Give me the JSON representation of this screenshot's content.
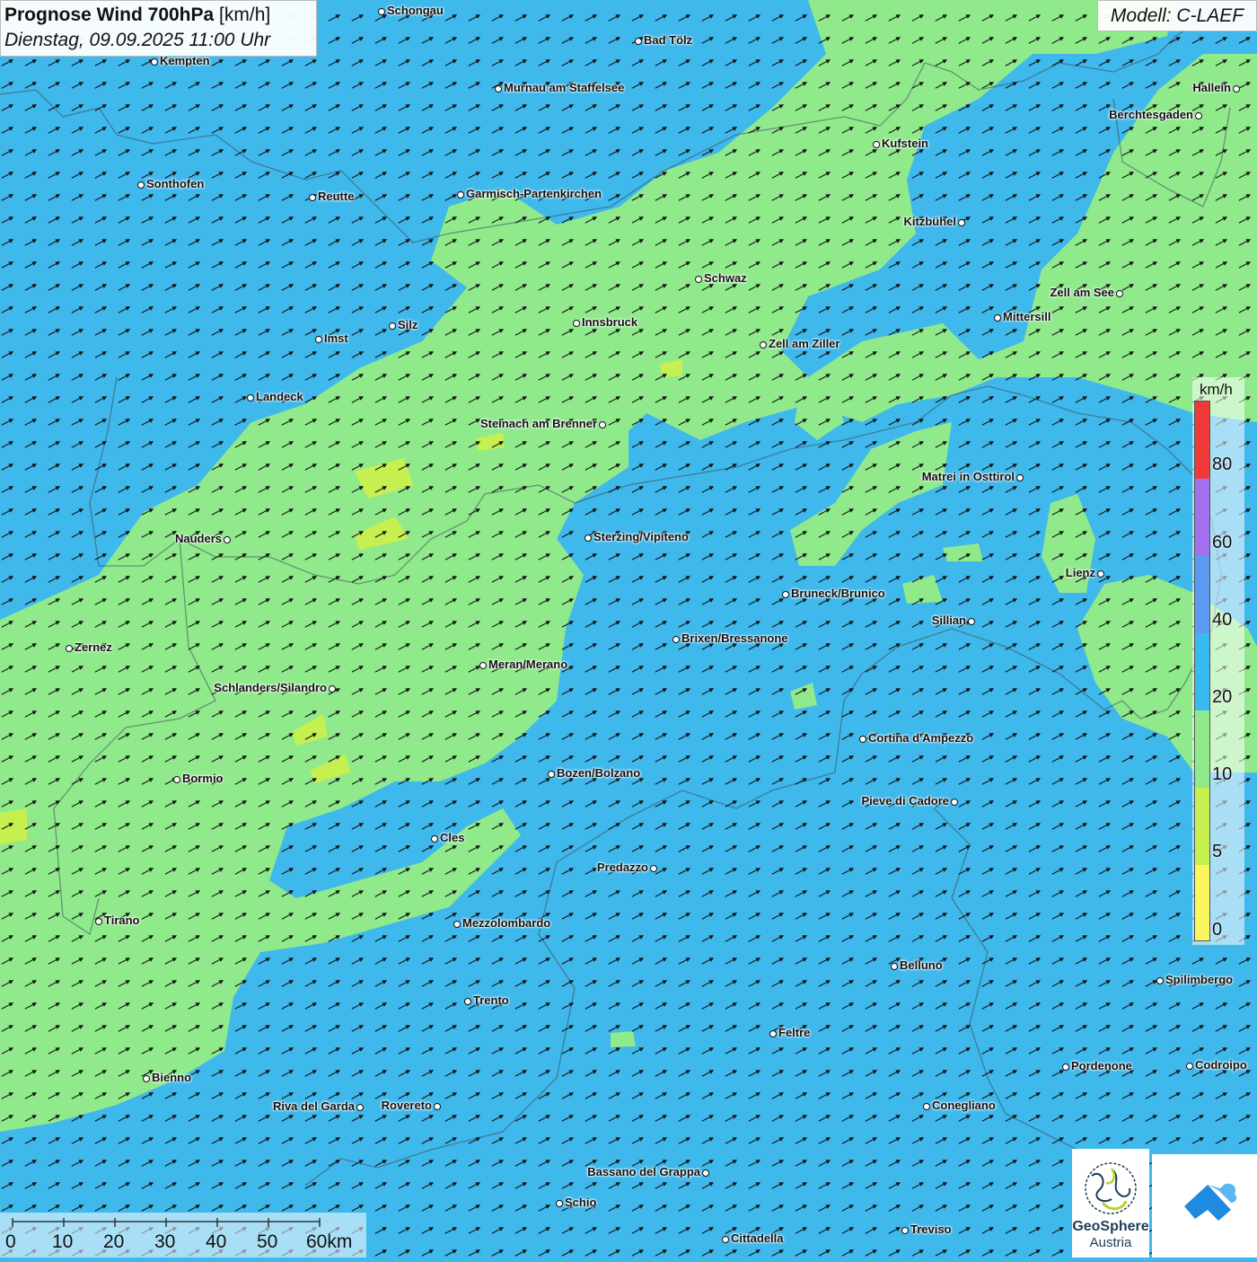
{
  "header": {
    "title_bold": "Prognose Wind 700hPa",
    "title_unit": "[km/h]",
    "datetime": "Dienstag, 09.09.2025 11:00 Uhr"
  },
  "model": "Modell: C-LAEF",
  "legend": {
    "unit": "km/h",
    "ticks": [
      "80",
      "60",
      "40",
      "20",
      "10",
      "5",
      "0"
    ],
    "colors": [
      "#f03a3a",
      "#a070ee",
      "#5a9af0",
      "#38b9ef",
      "#90ea8c",
      "#c5f050",
      "#fbf560"
    ]
  },
  "scalebar": {
    "labels": [
      "0",
      "10",
      "20",
      "30",
      "40",
      "50",
      "60km"
    ]
  },
  "logos": {
    "geosphere_line1": "GeoSphere",
    "geosphere_line2": "Austria"
  },
  "cities": [
    {
      "name": "Schongau"
    },
    {
      "name": "Bad Tölz"
    },
    {
      "name": "Kempten"
    },
    {
      "name": "Murnau am Staffelsee"
    },
    {
      "name": "Hallein"
    },
    {
      "name": "Berchtesgaden"
    },
    {
      "name": "Kufstein"
    },
    {
      "name": "Sonthofen"
    },
    {
      "name": "Reutte"
    },
    {
      "name": "Garmisch-Partenkirchen"
    },
    {
      "name": "Kitzbühel"
    },
    {
      "name": "Schwaz"
    },
    {
      "name": "Zell am See"
    },
    {
      "name": "Innsbruck"
    },
    {
      "name": "Mittersill"
    },
    {
      "name": "Silz"
    },
    {
      "name": "Imst"
    },
    {
      "name": "Zell am Ziller"
    },
    {
      "name": "Landeck"
    },
    {
      "name": "Steinach am Brenner"
    },
    {
      "name": "Matrei in Osttirol"
    },
    {
      "name": "Nauders"
    },
    {
      "name": "Sterzing/Vipiteno"
    },
    {
      "name": "Lienz"
    },
    {
      "name": "Bruneck/Brunico"
    },
    {
      "name": "Sillian"
    },
    {
      "name": "Brixen/Bressanone"
    },
    {
      "name": "Zernez"
    },
    {
      "name": "Meran/Merano"
    },
    {
      "name": "Schlanders/Silandro"
    },
    {
      "name": "Cortina d'Ampezzo"
    },
    {
      "name": "Bozen/Bolzano"
    },
    {
      "name": "Bormio"
    },
    {
      "name": "Pieve di Cadore"
    },
    {
      "name": "Cles"
    },
    {
      "name": "Predazzo"
    },
    {
      "name": "Tirano"
    },
    {
      "name": "Mezzolombardo"
    },
    {
      "name": "Belluno"
    },
    {
      "name": "Spilimbergo"
    },
    {
      "name": "Trento"
    },
    {
      "name": "Feltre"
    },
    {
      "name": "Pordenone"
    },
    {
      "name": "Codroipo"
    },
    {
      "name": "Bienno"
    },
    {
      "name": "Riva del Garda"
    },
    {
      "name": "Rovereto"
    },
    {
      "name": "Conegliano"
    },
    {
      "name": "Bassano del Grappa"
    },
    {
      "name": "Schio"
    },
    {
      "name": "Treviso"
    },
    {
      "name": "Cittadella"
    }
  ]
}
